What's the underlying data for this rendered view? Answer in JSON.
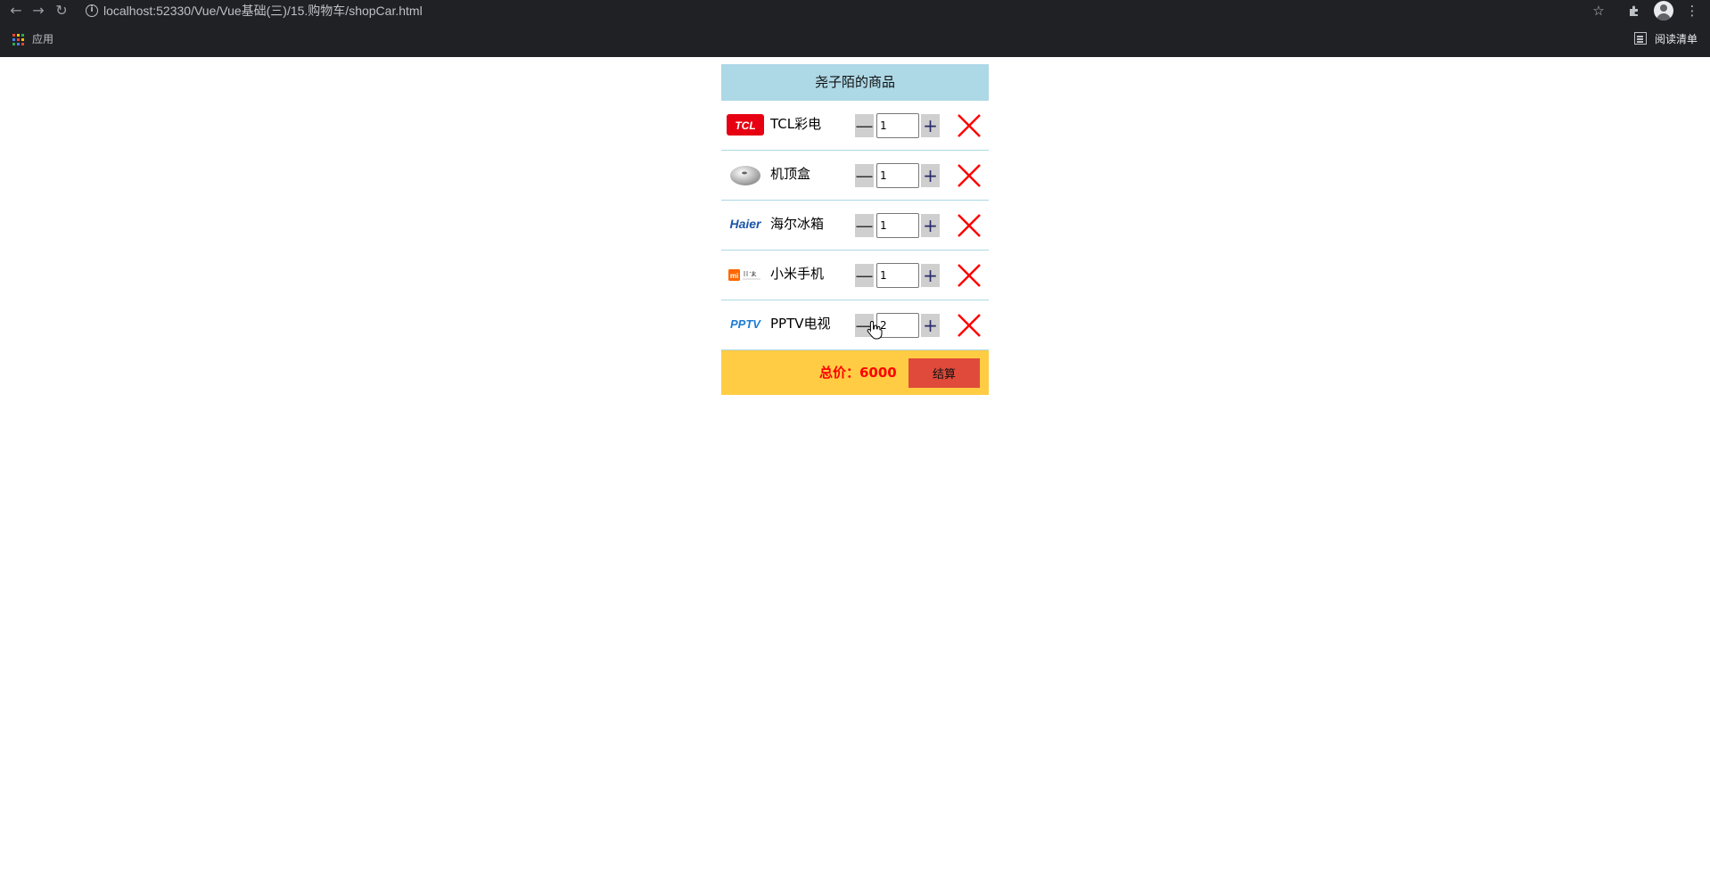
{
  "browser": {
    "url": "localhost:52330/Vue/Vue基础(三)/15.购物车/shopCar.html",
    "apps_label": "应用",
    "reading_list_label": "阅读清单"
  },
  "cart": {
    "title": "尧子陌的商品",
    "items": [
      {
        "name": "TCL彩电",
        "quantity": "1",
        "logo": "tcl-logo"
      },
      {
        "name": "机顶盒",
        "quantity": "1",
        "logo": "set-top-box-image"
      },
      {
        "name": "海尔冰箱",
        "quantity": "1",
        "logo": "haier-logo"
      },
      {
        "name": "小米手机",
        "quantity": "1",
        "logo": "xiaomi-logo"
      },
      {
        "name": "PPTV电视",
        "quantity": "2",
        "logo": "pptv-logo"
      }
    ],
    "minus_symbol": "—",
    "plus_symbol": "+",
    "total_label": "总价：6000",
    "checkout_label": "结算"
  },
  "colors": {
    "title_bg": "#add8e6",
    "footer_bg": "#ffcc44",
    "checkout_bg": "#e04a3a",
    "total_text": "#ff0000",
    "delete_icon": "#ff0000"
  }
}
